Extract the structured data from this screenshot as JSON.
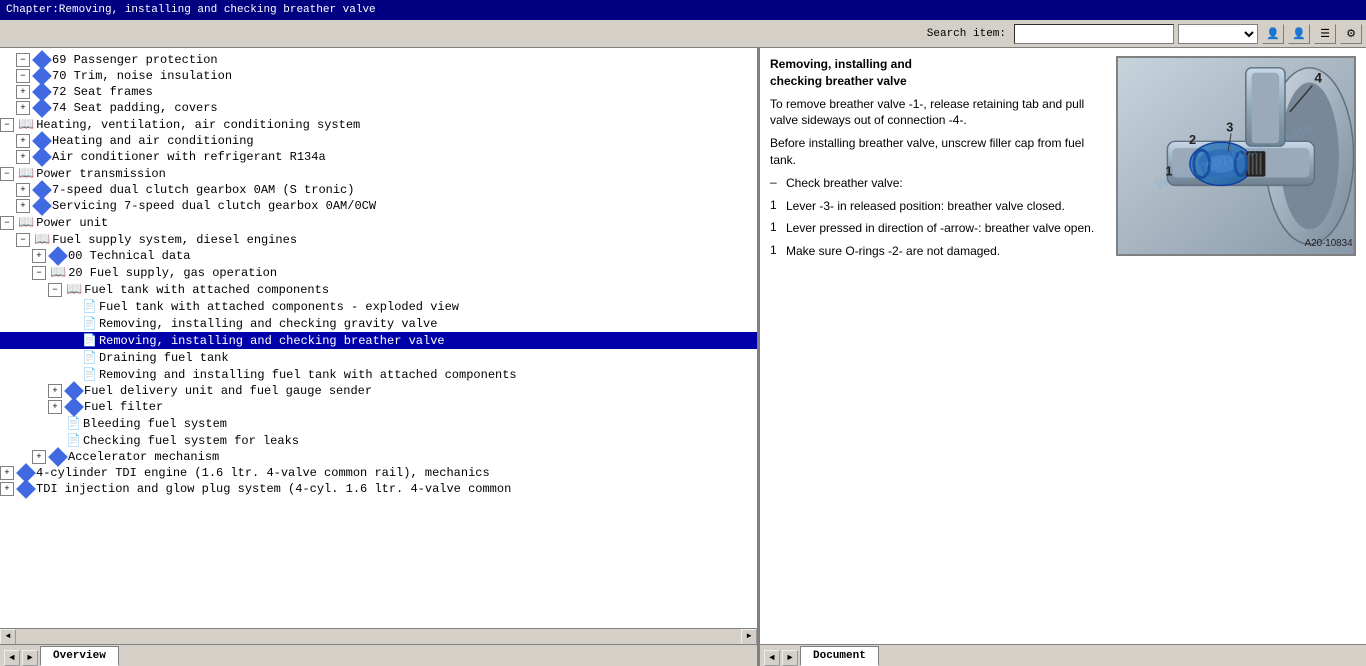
{
  "titleBar": {
    "text": "Chapter:Removing, installing and checking breather valve"
  },
  "toolbar": {
    "searchLabel": "Search item:",
    "searchPlaceholder": "",
    "searchValue": ""
  },
  "tree": {
    "items": [
      {
        "id": 1,
        "indent": 1,
        "type": "diamond",
        "toggled": true,
        "label": "69 Passenger protection"
      },
      {
        "id": 2,
        "indent": 1,
        "type": "diamond",
        "toggled": true,
        "label": "70 Trim, noise insulation"
      },
      {
        "id": 3,
        "indent": 1,
        "type": "diamond",
        "toggled": false,
        "label": "72 Seat frames"
      },
      {
        "id": 4,
        "indent": 1,
        "type": "diamond",
        "toggled": false,
        "label": "74 Seat padding, covers"
      },
      {
        "id": 5,
        "indent": 0,
        "type": "book-open",
        "toggled": true,
        "label": "Heating, ventilation, air conditioning system"
      },
      {
        "id": 6,
        "indent": 1,
        "type": "diamond",
        "toggled": false,
        "label": "Heating and air conditioning"
      },
      {
        "id": 7,
        "indent": 1,
        "type": "diamond",
        "toggled": false,
        "label": "Air conditioner with refrigerant R134a"
      },
      {
        "id": 8,
        "indent": 0,
        "type": "book-open",
        "toggled": true,
        "label": "Power transmission"
      },
      {
        "id": 9,
        "indent": 1,
        "type": "diamond",
        "toggled": false,
        "label": "7-speed dual clutch gearbox 0AM (S tronic)"
      },
      {
        "id": 10,
        "indent": 1,
        "type": "diamond",
        "toggled": false,
        "label": "Servicing 7-speed dual clutch gearbox 0AM/0CW"
      },
      {
        "id": 11,
        "indent": 0,
        "type": "book-open",
        "toggled": true,
        "label": "Power unit"
      },
      {
        "id": 12,
        "indent": 1,
        "type": "book-open",
        "toggled": true,
        "label": "Fuel supply system, diesel engines"
      },
      {
        "id": 13,
        "indent": 2,
        "type": "diamond",
        "toggled": false,
        "label": "00 Technical data"
      },
      {
        "id": 14,
        "indent": 2,
        "type": "book-open",
        "toggled": true,
        "label": "20 Fuel supply, gas operation"
      },
      {
        "id": 15,
        "indent": 3,
        "type": "book-open",
        "toggled": true,
        "label": "Fuel tank with attached components"
      },
      {
        "id": 16,
        "indent": 4,
        "type": "doc",
        "label": "Fuel tank with attached components - exploded view"
      },
      {
        "id": 17,
        "indent": 4,
        "type": "doc",
        "label": "Removing, installing and checking gravity valve"
      },
      {
        "id": 18,
        "indent": 4,
        "type": "doc",
        "label": "Removing, installing and checking breather valve",
        "selected": true
      },
      {
        "id": 19,
        "indent": 4,
        "type": "doc",
        "label": "Draining fuel tank"
      },
      {
        "id": 20,
        "indent": 4,
        "type": "doc",
        "label": "Removing and installing fuel tank with attached components"
      },
      {
        "id": 21,
        "indent": 3,
        "type": "diamond",
        "toggled": false,
        "label": "Fuel delivery unit and fuel gauge sender"
      },
      {
        "id": 22,
        "indent": 3,
        "type": "diamond",
        "toggled": false,
        "label": "Fuel filter"
      },
      {
        "id": 23,
        "indent": 3,
        "type": "doc",
        "label": "Bleeding fuel system"
      },
      {
        "id": 24,
        "indent": 3,
        "type": "doc",
        "label": "Checking fuel system for leaks"
      },
      {
        "id": 25,
        "indent": 2,
        "type": "diamond",
        "toggled": false,
        "label": "Accelerator mechanism"
      },
      {
        "id": 26,
        "indent": 0,
        "type": "diamond",
        "toggled": false,
        "label": "4-cylinder TDI engine (1.6 ltr. 4-valve common rail), mechanics"
      },
      {
        "id": 27,
        "indent": 0,
        "type": "diamond",
        "toggled": false,
        "label": "TDI injection and glow plug system (4-cyl. 1.6 ltr. 4-valve common"
      }
    ]
  },
  "leftTabs": {
    "overviewLabel": "Overview",
    "navLeft": "◄",
    "navRight": "►"
  },
  "rightPanel": {
    "title": "Removing, installing and\nchecking breather valve",
    "paragraphs": [
      {
        "num": "",
        "text": "To remove breather valve -1-, release retaining tab and pull valve sideways out of connection -4-."
      },
      {
        "num": "",
        "text": "Before installing breather valve, unscrew filler cap from fuel tank."
      },
      {
        "num": "–",
        "text": "Check breather valve:"
      },
      {
        "num": "1",
        "text": "Lever -3- in released position: breather valve closed."
      },
      {
        "num": "1",
        "text": "Lever pressed in direction of -arrow-: breather valve open."
      },
      {
        "num": "1",
        "text": "Make sure O-rings -2- are not damaged."
      }
    ],
    "imageLabel": "A20-10834",
    "imageNumbers": [
      "1",
      "2",
      "3",
      "4"
    ],
    "watermark": "www.manuals.co.uk"
  },
  "rightTabs": {
    "documentLabel": "Document",
    "navLeft": "◄",
    "navRight": "►"
  }
}
